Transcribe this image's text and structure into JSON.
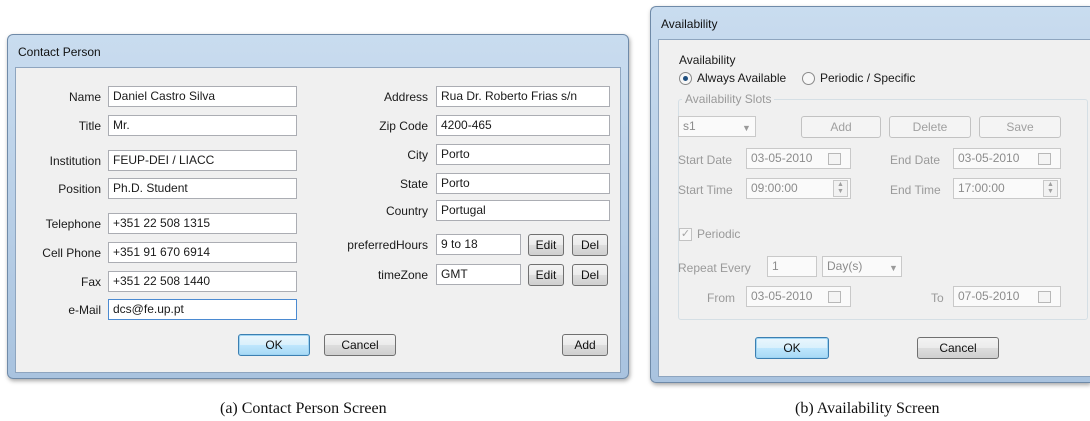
{
  "contact": {
    "title": "Contact Person",
    "labels": {
      "name": "Name",
      "title": "Title",
      "institution": "Institution",
      "position": "Position",
      "telephone": "Telephone",
      "cell_phone": "Cell Phone",
      "fax": "Fax",
      "email": "e-Mail",
      "address": "Address",
      "zip": "Zip Code",
      "city": "City",
      "state": "State",
      "country": "Country",
      "preferred_hours": "preferredHours",
      "timezone": "timeZone"
    },
    "values": {
      "name": "Daniel Castro Silva",
      "title": "Mr.",
      "institution": "FEUP-DEI / LIACC",
      "position": "Ph.D. Student",
      "telephone": "+351 22 508 1315",
      "cell_phone": "+351 91 670 6914",
      "fax": "+351 22 508 1440",
      "email": "dcs@fe.up.pt",
      "address": "Rua Dr. Roberto Frias s/n",
      "zip": "4200-465",
      "city": "Porto",
      "state": "Porto",
      "country": "Portugal",
      "preferred_hours": "9 to 18",
      "timezone": "GMT"
    },
    "buttons": {
      "edit": "Edit",
      "del": "Del",
      "ok": "OK",
      "cancel": "Cancel",
      "add": "Add"
    }
  },
  "availability": {
    "title": "Availability",
    "section_label": "Availability",
    "radio_always": "Always Available",
    "radio_periodic": "Periodic / Specific",
    "group_title": "Availability Slots",
    "slot_value": "s1",
    "buttons": {
      "add": "Add",
      "delete": "Delete",
      "save": "Save",
      "ok": "OK",
      "cancel": "Cancel"
    },
    "labels": {
      "start_date": "Start Date",
      "end_date": "End Date",
      "start_time": "Start Time",
      "end_time": "End Time",
      "periodic": "Periodic",
      "repeat_every": "Repeat Every",
      "from": "From",
      "to": "To"
    },
    "values": {
      "start_date": "03-05-2010",
      "end_date": "03-05-2010",
      "start_time": "09:00:00",
      "end_time": "17:00:00",
      "repeat": "1",
      "unit": "Day(s)",
      "from": "03-05-2010",
      "to": "07-05-2010"
    }
  },
  "captions": {
    "a": "(a) Contact Person Screen",
    "b": "(b) Availability Screen"
  },
  "colors": {
    "frame": "#b4cbe4",
    "accent": "#3c7fb1",
    "radio_selected": "#1f4f7f"
  }
}
